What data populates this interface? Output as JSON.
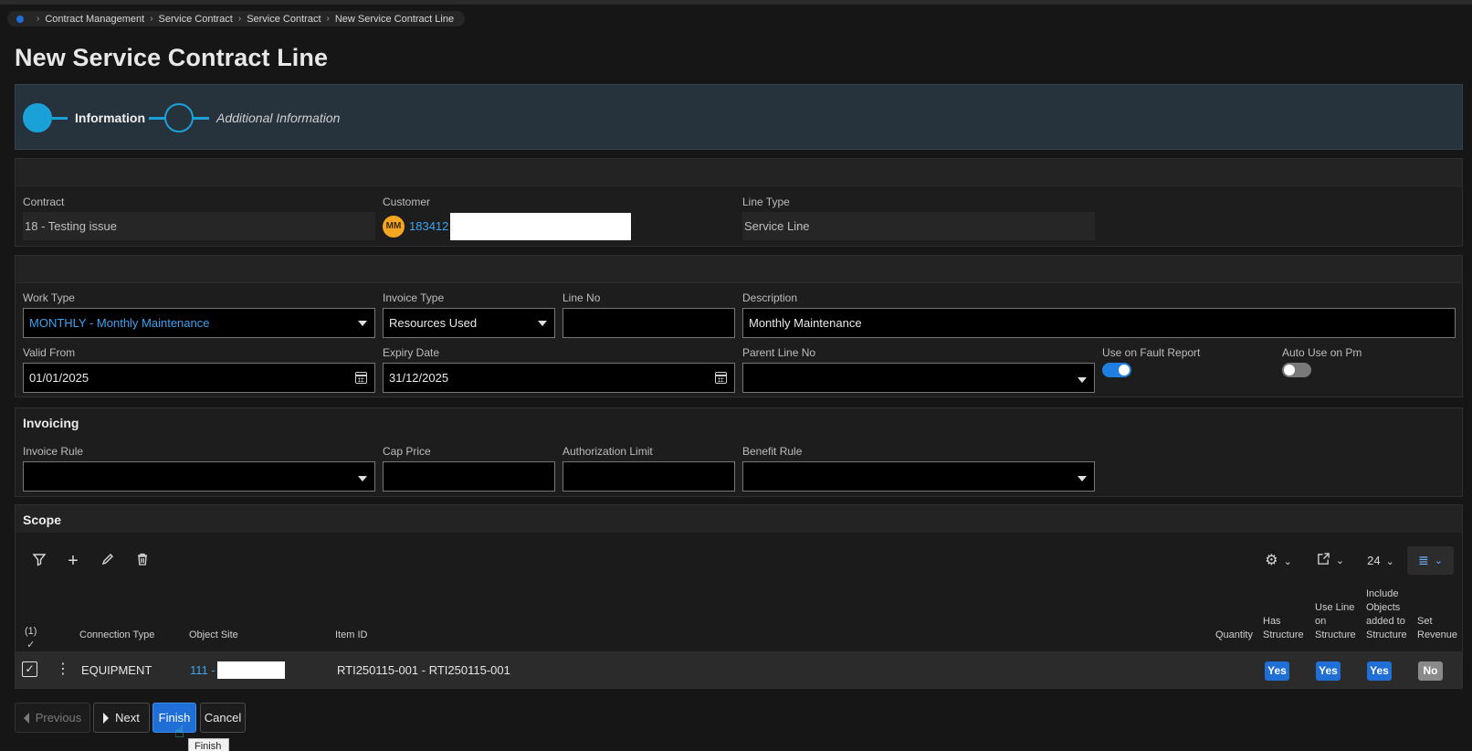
{
  "breadcrumb": [
    "Contract Management",
    "Service Contract",
    "Service Contract",
    "New Service Contract Line"
  ],
  "page_title": "New Service Contract Line",
  "wizard": {
    "steps": [
      {
        "label": "Information",
        "active": true
      },
      {
        "label": "Additional Information",
        "active": false
      }
    ]
  },
  "header": {
    "contract_label": "Contract",
    "contract_value": "18 - Testing issue",
    "customer_label": "Customer",
    "customer_initials": "MM",
    "customer_id": "183412",
    "line_type_label": "Line Type",
    "line_type_value": "Service Line"
  },
  "general": {
    "work_type_label": "Work Type",
    "work_type_value": "MONTHLY - Monthly Maintenance",
    "invoice_type_label": "Invoice Type",
    "invoice_type_value": "Resources Used",
    "line_no_label": "Line No",
    "line_no_value": "",
    "description_label": "Description",
    "description_value": "Monthly Maintenance",
    "valid_from_label": "Valid From",
    "valid_from_value": "01/01/2025",
    "expiry_label": "Expiry Date",
    "expiry_value": "31/12/2025",
    "parent_line_label": "Parent Line No",
    "parent_line_value": "",
    "fault_report_label": "Use on Fault Report",
    "fault_report_on": true,
    "auto_pm_label": "Auto Use on Pm",
    "auto_pm_on": false
  },
  "invoicing": {
    "title": "Invoicing",
    "invoice_rule_label": "Invoice Rule",
    "cap_price_label": "Cap Price",
    "auth_limit_label": "Authorization Limit",
    "benefit_rule_label": "Benefit Rule"
  },
  "scope": {
    "title": "Scope",
    "page_size": "24",
    "selected_count": "(1)",
    "columns": {
      "connection_type": "Connection Type",
      "object_site": "Object Site",
      "item_id": "Item ID",
      "quantity": "Quantity",
      "has_structure": "Has Structure",
      "use_line": "Use Line on Structure",
      "include_objects": "Include Objects added to Structure",
      "set_revenue": "Set Revenue"
    },
    "row": {
      "connection_type": "EQUIPMENT",
      "object_site": "111 -",
      "item_id": "RTI250115-001 - RTI250115-001",
      "has_structure": "Yes",
      "use_line": "Yes",
      "include_objects": "Yes",
      "set_revenue": "No"
    }
  },
  "footer": {
    "previous": "Previous",
    "next": "Next",
    "finish": "Finish",
    "cancel": "Cancel",
    "tooltip": "Finish"
  },
  "colors": {
    "accent": "#1aa1d8",
    "primary": "#1f6fd6",
    "link": "#3ba3f0"
  }
}
